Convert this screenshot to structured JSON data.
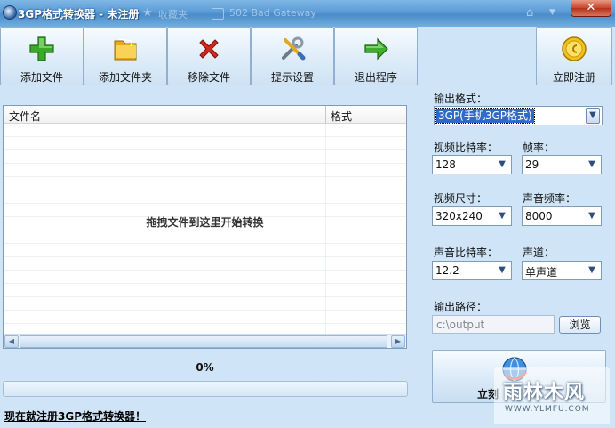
{
  "window": {
    "title": "3GP格式转换器 - 未注册",
    "close_symbol": "✕"
  },
  "browser_ghost": {
    "bookmarks": "收藏夹",
    "tab_title": "502 Bad Gateway"
  },
  "toolbar": [
    {
      "label": "添加文件",
      "icon": "add-file-icon"
    },
    {
      "label": "添加文件夹",
      "icon": "folder-icon"
    },
    {
      "label": "移除文件",
      "icon": "remove-icon"
    },
    {
      "label": "提示设置",
      "icon": "settings-tools-icon"
    },
    {
      "label": "退出程序",
      "icon": "exit-arrow-icon"
    }
  ],
  "register_button": {
    "label": "立即注册",
    "icon": "coin-icon"
  },
  "file_list": {
    "columns": [
      "文件名",
      "格式"
    ],
    "empty_hint": "拖拽文件到这里开始转换"
  },
  "progress": {
    "percent_text": "0%",
    "value": 0
  },
  "register_link": "现在就注册3GP格式转换器！",
  "settings": {
    "output_format": {
      "label": "输出格式：",
      "value": "3GP(手机3GP格式)"
    },
    "video_bitrate": {
      "label": "视频比特率：",
      "value": "128"
    },
    "frame_rate": {
      "label": "帧率：",
      "value": "29"
    },
    "video_size": {
      "label": "视频尺寸：",
      "value": "320x240"
    },
    "audio_freq": {
      "label": "声音频率：",
      "value": "8000"
    },
    "audio_bitrate": {
      "label": "声音比特率：",
      "value": "12.2"
    },
    "channels": {
      "label": "声道：",
      "value": "单声道"
    },
    "output_path": {
      "label": "输出路径：",
      "value": "c:\\output"
    },
    "browse_label": "浏览"
  },
  "start_button": {
    "label": "立刻",
    "icon": "convert-globe-icon"
  },
  "watermark": {
    "text": "雨林木风",
    "url": "WWW.YLMFU.COM"
  }
}
